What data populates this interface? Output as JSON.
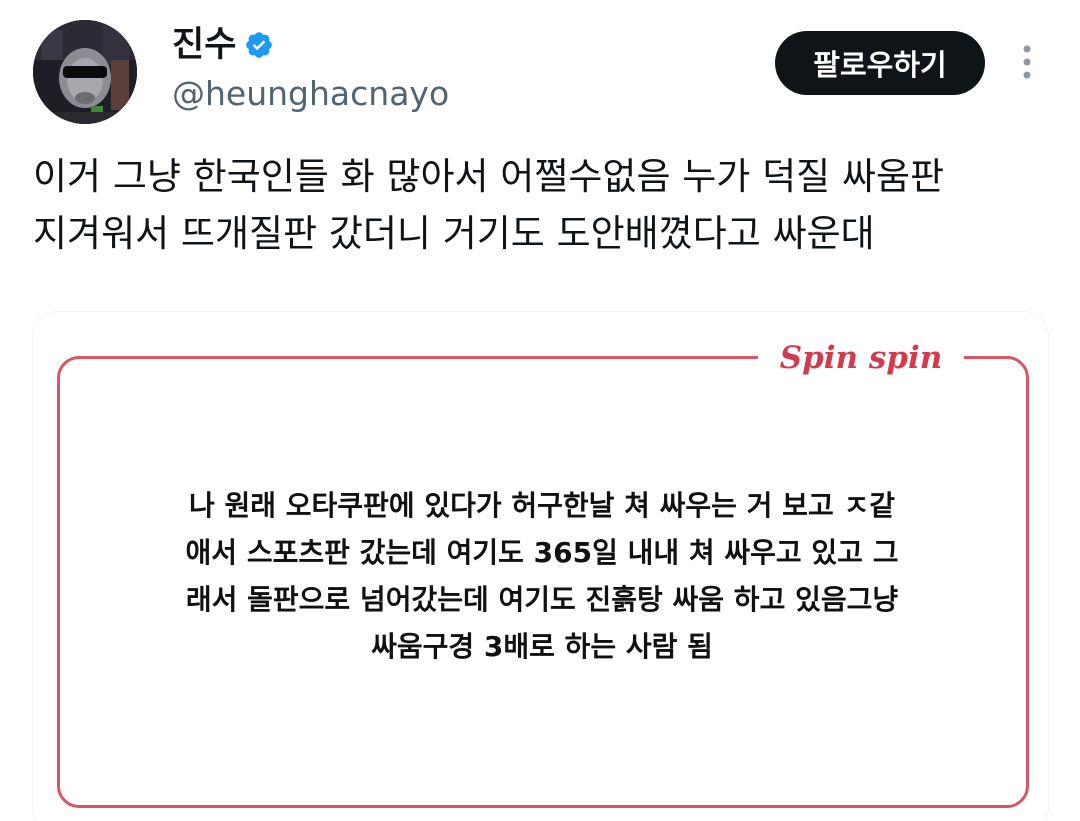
{
  "author": {
    "display_name": "진수",
    "handle": "@heunghacnayo",
    "verified": true,
    "avatar_icon": "avatar-masked-figure-sunglasses"
  },
  "actions": {
    "follow_label": "팔로우하기",
    "more_icon": "vertical-dots-icon"
  },
  "tweet": {
    "lines": [
      "이거 그냥 한국인들 화 많아서 어쩔수없음 누가 덕질 싸움판",
      "지겨워서 뜨개질판 갔더니 거기도 도안배꼈다고 싸운대"
    ]
  },
  "media": {
    "brand": "Spin spin",
    "text_lines": [
      "나 원래 오타쿠판에 있다가 허구한날 쳐 싸우는 거 보고 ㅈ같",
      "애서 스포츠판 갔는데 여기도 365일 내내 쳐 싸우고 있고 그",
      "래서 돌판으로 넘어갔는데 여기도 진흙탕 싸움 하고 있음그냥",
      "싸움구경 3배로 하는 사람 됨"
    ]
  },
  "colors": {
    "text": "#0f1419",
    "secondary": "#536471",
    "verified": "#1d9bf0",
    "follow_bg": "#0f1419",
    "frame": "#d65665",
    "brand": "#d33a4d"
  }
}
